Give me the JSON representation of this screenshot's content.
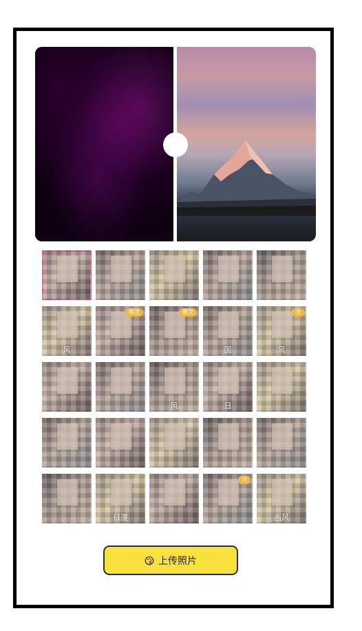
{
  "compare": {
    "left_label": "",
    "right_label": ""
  },
  "grid": {
    "items": [
      {
        "label": "",
        "badge": "",
        "tone": "tone-a",
        "selected": true
      },
      {
        "label": "",
        "badge": "",
        "tone": "tone-b"
      },
      {
        "label": "",
        "badge": "",
        "tone": "tone-c"
      },
      {
        "label": "",
        "badge": "",
        "tone": "tone-b"
      },
      {
        "label": "",
        "badge": "",
        "tone": "tone-d"
      },
      {
        "label": "风",
        "badge": "",
        "tone": "tone-c"
      },
      {
        "label": "",
        "badge": "限次",
        "tone": "tone-a"
      },
      {
        "label": "",
        "badge": "限次",
        "tone": "tone-d"
      },
      {
        "label": "国",
        "badge": "",
        "tone": "tone-b"
      },
      {
        "label": "风",
        "badge": "次",
        "tone": "tone-c"
      },
      {
        "label": "",
        "badge": "",
        "tone": "tone-a"
      },
      {
        "label": "",
        "badge": "",
        "tone": "tone-b"
      },
      {
        "label": "风",
        "badge": "",
        "tone": "tone-d"
      },
      {
        "label": "日",
        "badge": "",
        "tone": "tone-a"
      },
      {
        "label": "",
        "badge": "",
        "tone": "tone-c"
      },
      {
        "label": "",
        "badge": "",
        "tone": "tone-b"
      },
      {
        "label": "",
        "badge": "",
        "tone": "tone-a"
      },
      {
        "label": "",
        "badge": "",
        "tone": "tone-c"
      },
      {
        "label": "",
        "badge": "",
        "tone": "tone-d"
      },
      {
        "label": "",
        "badge": "",
        "tone": "tone-b"
      },
      {
        "label": "",
        "badge": "",
        "tone": "tone-d"
      },
      {
        "label": "日漫",
        "badge": "",
        "tone": "tone-c"
      },
      {
        "label": "",
        "badge": "",
        "tone": "tone-a"
      },
      {
        "label": "",
        "badge": "次",
        "tone": "tone-b"
      },
      {
        "label": "画风",
        "badge": "",
        "tone": "tone-c"
      }
    ]
  },
  "upload": {
    "label": "上传照片",
    "icon": "palette-icon",
    "color": "#f9e240"
  },
  "colors": {
    "frame_border": "#000000",
    "accent_badge": "#f2b742",
    "selected_outline": "#e0608a"
  }
}
